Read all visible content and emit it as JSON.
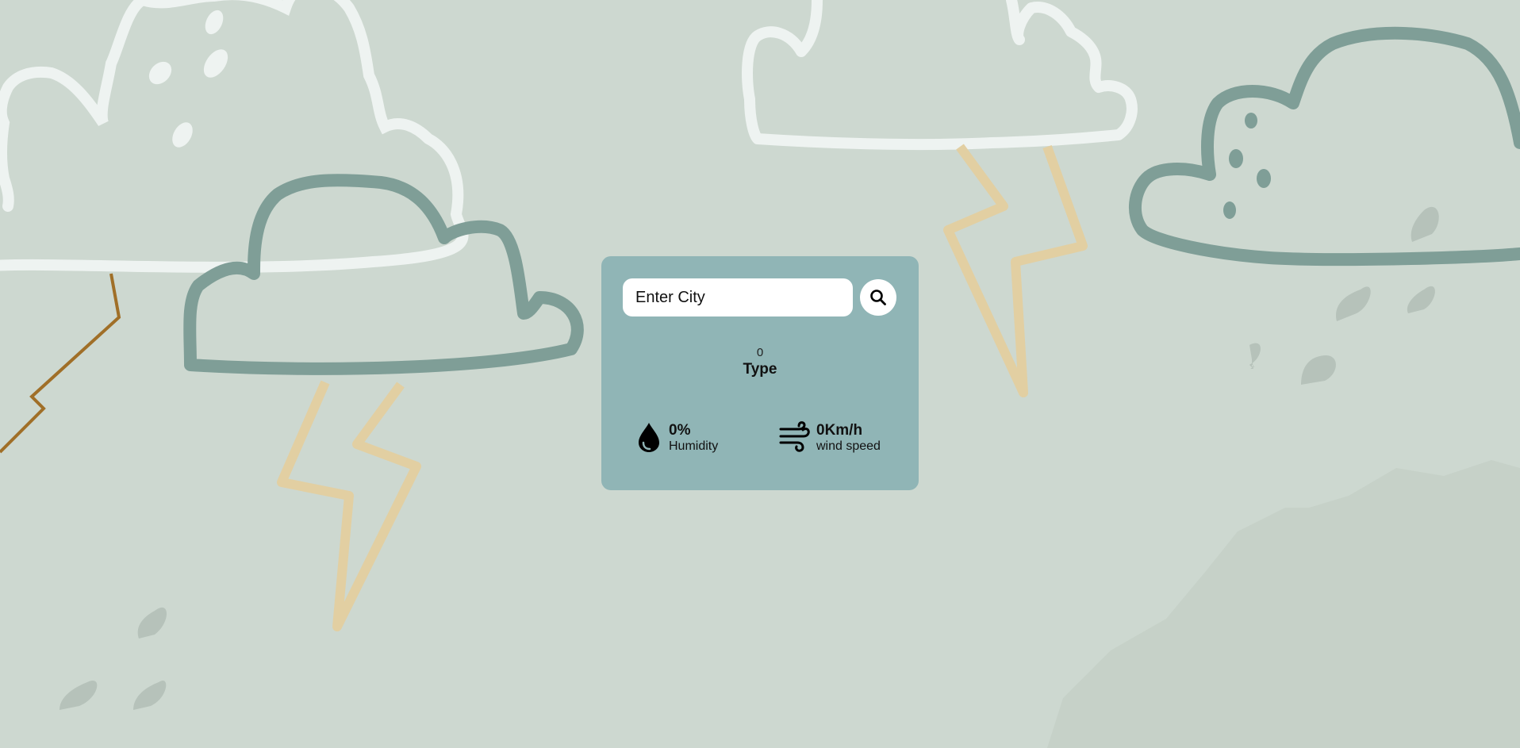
{
  "search": {
    "placeholder": "Enter City",
    "icon": "search-icon"
  },
  "weather": {
    "temperature": "0",
    "type": "Type"
  },
  "metrics": {
    "humidity": {
      "value": "0%",
      "label": "Humidity",
      "icon": "water-drop-icon"
    },
    "wind": {
      "value": "0Km/h",
      "label": "wind speed",
      "icon": "wind-icon"
    }
  },
  "colors": {
    "background": "#cdd8d0",
    "card": "#90b5b6",
    "cloud_dark": "#7f9e97",
    "cloud_light": "#eef3f1",
    "lightning": "#e2cfa2"
  }
}
